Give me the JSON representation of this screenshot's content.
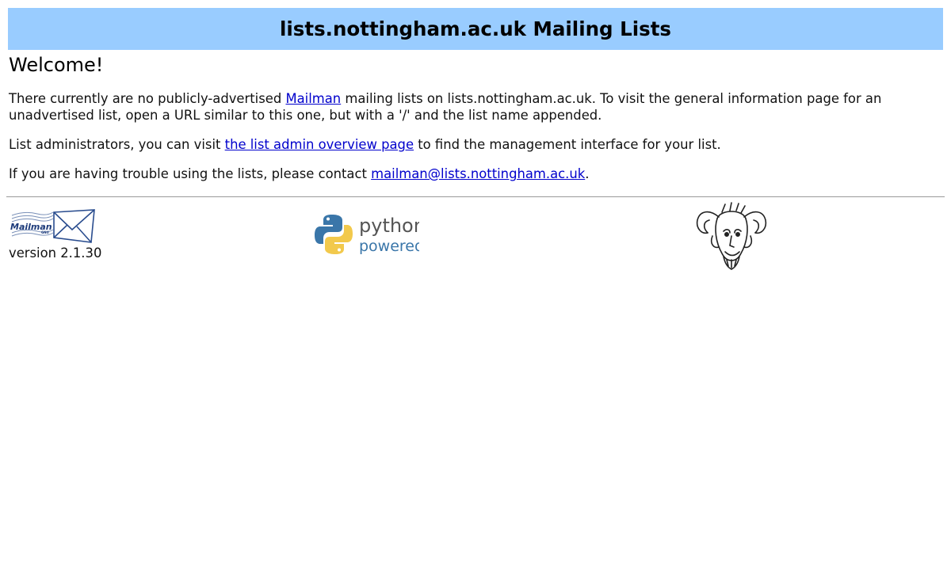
{
  "header": {
    "title": "lists.nottingham.ac.uk Mailing Lists",
    "background_color": "#99ccff"
  },
  "welcome": {
    "heading": "Welcome!"
  },
  "intro": {
    "before_link": "There currently are no publicly-advertised ",
    "link": "Mailman",
    "after_link": " mailing lists on lists.nottingham.ac.uk. To visit the general information page for an unadvertised list, open a URL similar to this one, but with a '/' and the list name appended."
  },
  "admin": {
    "before_link": "List administrators, you can visit ",
    "link": "the list admin overview page",
    "after_link": " to find the management interface for your list."
  },
  "contact": {
    "before_link": "If you are having trouble using the lists, please contact ",
    "link": "mailman@lists.nottingham.ac.uk",
    "after_link": "."
  },
  "footer": {
    "mailman_logo_text": "Mailman",
    "mailman_logo_small": "GNU",
    "version": "version 2.1.30",
    "python_line1": "python",
    "python_line2": "powered",
    "icons": [
      "mailman-logo-icon",
      "python-powered-icon",
      "gnu-head-icon"
    ]
  },
  "colors": {
    "link": "#0000cc",
    "python_blue": "#3a76a9",
    "python_yellow": "#f2c94c"
  }
}
